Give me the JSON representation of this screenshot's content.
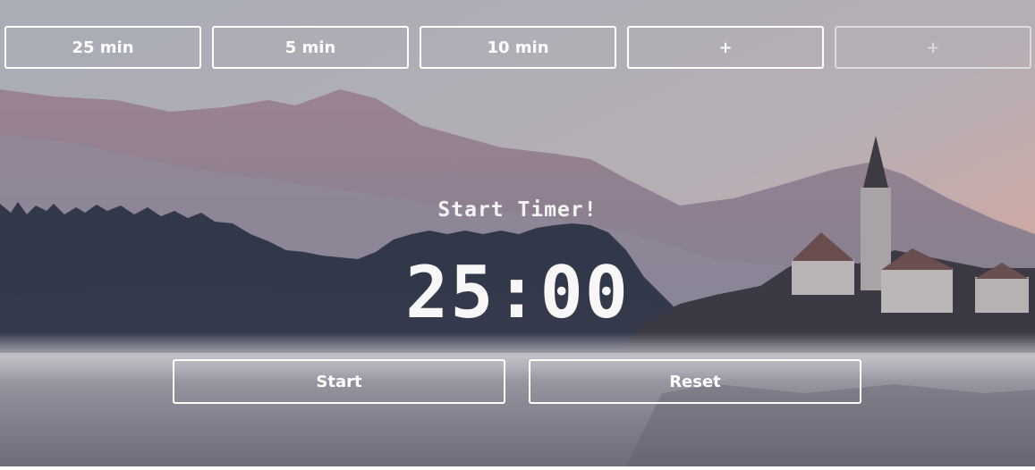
{
  "background": {
    "description_icon": "mountain-lake-church-photo",
    "colors": {
      "sky_top": "#a9aeb6",
      "sky_glow": "#e3a995",
      "mountain": "#8e8494",
      "forest": "#2f3748",
      "water": "#8b8995"
    }
  },
  "presets": [
    {
      "label": "25 min"
    },
    {
      "label": "5 min"
    },
    {
      "label": "10 min"
    },
    {
      "label": "+"
    },
    {
      "label": "+"
    }
  ],
  "timer": {
    "label": "Start Timer!",
    "display": "25:00"
  },
  "controls": {
    "start_label": "Start",
    "reset_label": "Reset"
  }
}
